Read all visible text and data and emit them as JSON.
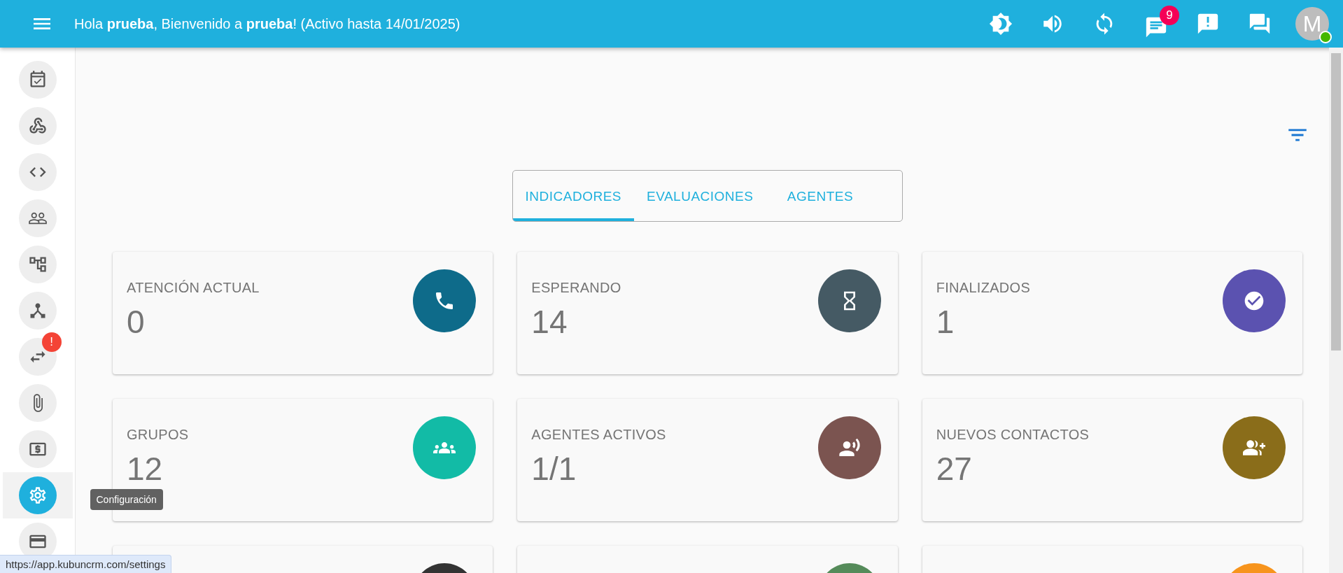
{
  "header": {
    "greeting": "Hola **prueba**, Bienvenido a **prueba**! (Activo hasta 14/01/2025)",
    "notification_badge": "9",
    "avatar": {
      "initial": "M",
      "online": true
    }
  },
  "sidebar": {
    "items": [
      {
        "selected": false
      },
      {
        "selected": false
      },
      {
        "selected": false
      },
      {
        "selected": false
      },
      {
        "selected": false
      },
      {
        "selected": false
      },
      {
        "selected": false,
        "badge": "!"
      },
      {
        "selected": false
      },
      {
        "selected": false
      },
      {
        "selected": true,
        "tooltip": "Configuración"
      },
      {
        "selected": false
      }
    ]
  },
  "tabs": [
    {
      "label": "INDICADORES",
      "selected": true
    },
    {
      "label": "EVALUACIONES",
      "selected": false
    },
    {
      "label": "AGENTES",
      "selected": false
    }
  ],
  "cards": [
    {
      "title": "ATENCIÓN ACTUAL",
      "value": "0",
      "color": "#0e6b8a"
    },
    {
      "title": "ESPERANDO",
      "value": "14",
      "color": "#455a64"
    },
    {
      "title": "FINALIZADOS",
      "value": "1",
      "color": "#5b52b0"
    },
    {
      "title": "GRUPOS",
      "value": "12",
      "color": "#12bba6"
    },
    {
      "title": "AGENTES ACTIVOS",
      "value": "1/1",
      "color": "#7b5450"
    },
    {
      "title": "NUEVOS CONTACTOS",
      "value": "27",
      "color": "#8a6d1a"
    },
    {
      "color": "#333333"
    },
    {
      "color": "#558b5a"
    },
    {
      "color": "#f7941d"
    }
  ],
  "status_bar": {
    "url": "https://app.kubuncrm.com/settings"
  }
}
